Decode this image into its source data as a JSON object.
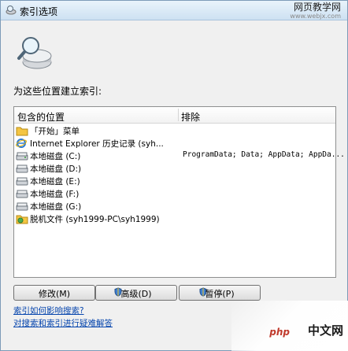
{
  "window": {
    "title": "索引选项"
  },
  "watermark_top": {
    "line1": "网页教学网",
    "line2": "www.webjx.com"
  },
  "section_title": "为这些位置建立索引:",
  "table": {
    "headers": [
      "包含的位置",
      "排除"
    ],
    "rows": [
      {
        "icon": "start-menu-folder-icon",
        "name": "「开始」菜单",
        "exclude": ""
      },
      {
        "icon": "internet-explorer-icon",
        "name": "Internet Explorer 历史记录 (syh...",
        "exclude": ""
      },
      {
        "icon": "local-disk-icon",
        "name": "本地磁盘 (C:)",
        "exclude": "ProgramData; Data; AppData; AppDa..."
      },
      {
        "icon": "local-disk-icon",
        "name": "本地磁盘 (D:)",
        "exclude": ""
      },
      {
        "icon": "local-disk-icon",
        "name": "本地磁盘 (E:)",
        "exclude": ""
      },
      {
        "icon": "local-disk-icon",
        "name": "本地磁盘 (F:)",
        "exclude": ""
      },
      {
        "icon": "local-disk-icon",
        "name": "本地磁盘 (G:)",
        "exclude": ""
      },
      {
        "icon": "offline-files-icon",
        "name": "脱机文件 (syh1999-PC\\syh1999)",
        "exclude": ""
      }
    ]
  },
  "buttons": {
    "modify": "修改(M)",
    "advanced": "高级(D)",
    "pause": "暂停(P)"
  },
  "links": {
    "how_affects": "索引如何影响搜索?",
    "troubleshoot": "对搜索和索引进行疑难解答"
  },
  "watermark_bottom": {
    "lead": "php",
    "text": "中文网"
  },
  "colors": {
    "link": "#0645ad",
    "titlebar": "#cde1f2",
    "folder": "#f4c542"
  }
}
